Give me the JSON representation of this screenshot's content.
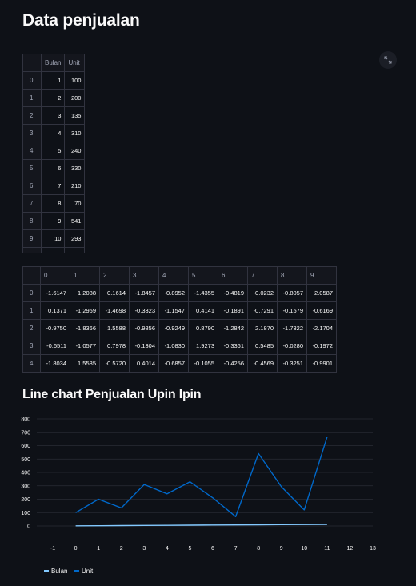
{
  "page": {
    "title": "Data penjualan",
    "chart_title": "Line chart Penjualan Upin Ipin"
  },
  "table1": {
    "columns": [
      "",
      "Bulan",
      "Unit"
    ],
    "rows": [
      {
        "index": "0",
        "bulan": "1",
        "unit": "100"
      },
      {
        "index": "1",
        "bulan": "2",
        "unit": "200"
      },
      {
        "index": "2",
        "bulan": "3",
        "unit": "135"
      },
      {
        "index": "3",
        "bulan": "4",
        "unit": "310"
      },
      {
        "index": "4",
        "bulan": "5",
        "unit": "240"
      },
      {
        "index": "5",
        "bulan": "6",
        "unit": "330"
      },
      {
        "index": "6",
        "bulan": "7",
        "unit": "210"
      },
      {
        "index": "7",
        "bulan": "8",
        "unit": "70"
      },
      {
        "index": "8",
        "bulan": "9",
        "unit": "541"
      },
      {
        "index": "9",
        "bulan": "10",
        "unit": "293"
      }
    ]
  },
  "table2": {
    "columns": [
      "",
      "0",
      "1",
      "2",
      "3",
      "4",
      "5",
      "6",
      "7",
      "8",
      "9"
    ],
    "rows": [
      {
        "index": "0",
        "values": [
          "-1.6147",
          "1.2088",
          "0.1614",
          "-1.8457",
          "-0.8952",
          "-1.4355",
          "-0.4819",
          "-0.0232",
          "-0.8057",
          "2.0587"
        ]
      },
      {
        "index": "1",
        "values": [
          "0.1371",
          "-1.2959",
          "-1.4698",
          "-0.3323",
          "-1.1547",
          "0.4141",
          "-0.1891",
          "-0.7291",
          "-0.1579",
          "-0.6169"
        ]
      },
      {
        "index": "2",
        "values": [
          "-0.9750",
          "-1.8366",
          "1.5588",
          "-0.9856",
          "-0.9249",
          "0.8790",
          "-1.2842",
          "2.1870",
          "-1.7322",
          "-2.1704"
        ]
      },
      {
        "index": "3",
        "values": [
          "-0.6511",
          "-1.0577",
          "0.7978",
          "-0.1304",
          "-1.0830",
          "1.9273",
          "-0.3361",
          "0.5485",
          "-0.0280",
          "-0.1972"
        ]
      },
      {
        "index": "4",
        "values": [
          "-1.8034",
          "1.5585",
          "-0.5720",
          "0.4014",
          "-0.6857",
          "-0.1055",
          "-0.4256",
          "-0.4569",
          "-0.3251",
          "-0.9901"
        ]
      }
    ]
  },
  "icons": {
    "expand": "expand-icon"
  },
  "colors": {
    "background": "#0e1117",
    "bulan": "#83c9ff",
    "unit": "#0068c9",
    "grid": "#2a2d36"
  },
  "chart_data": {
    "type": "line",
    "x": [
      0,
      1,
      2,
      3,
      4,
      5,
      6,
      7,
      8,
      9,
      10,
      11
    ],
    "series": [
      {
        "name": "Bulan",
        "values": [
          1,
          2,
          3,
          4,
          5,
          6,
          7,
          8,
          9,
          10,
          11,
          12
        ]
      },
      {
        "name": "Unit",
        "values": [
          100,
          200,
          135,
          310,
          240,
          330,
          210,
          70,
          541,
          293,
          120,
          665
        ]
      }
    ],
    "xticks": [
      -1,
      0,
      1,
      2,
      3,
      4,
      5,
      6,
      7,
      8,
      9,
      10,
      11,
      12,
      13
    ],
    "yticks": [
      0,
      100,
      200,
      300,
      400,
      500,
      600,
      700,
      800
    ],
    "xlim": [
      -1,
      13
    ],
    "ylim": [
      0,
      800
    ],
    "grid": true,
    "legend_position": "bottom-left"
  }
}
